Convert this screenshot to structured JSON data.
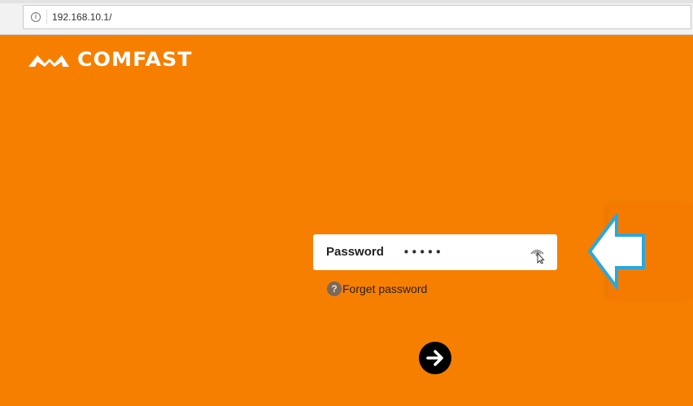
{
  "browser": {
    "url": "192.168.10.1/",
    "info_icon": "info-icon"
  },
  "brand": {
    "logo_text": "COMFAST",
    "logo_icon": "comfast-logo-icon",
    "accent_color": "#f77f00"
  },
  "login": {
    "password_label": "Password",
    "password_value": "•••••",
    "eye_icon": "eye-icon",
    "forget_label": "Forget password",
    "help_icon": "question-icon",
    "submit_icon": "arrow-right-icon"
  },
  "overlay": {
    "pointer_icon": "arrow-left-outline-icon",
    "pointer_color": "#29a8e0"
  }
}
